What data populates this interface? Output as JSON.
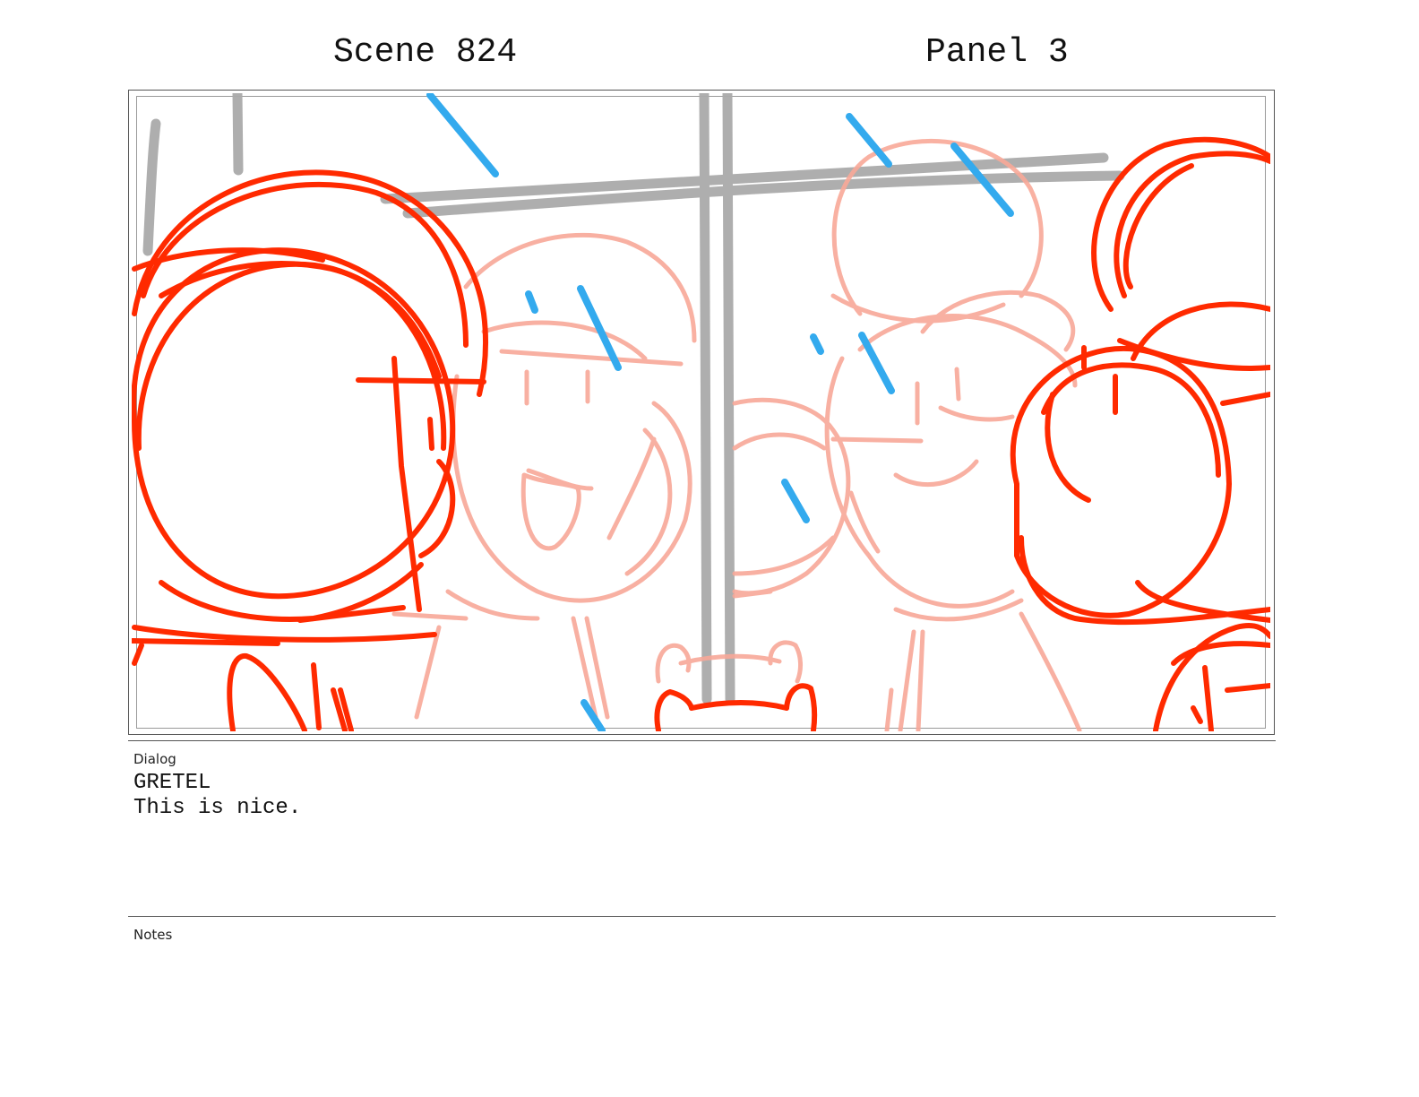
{
  "header": {
    "scene": "Scene 824",
    "panel": "Panel 3"
  },
  "dialog": {
    "label": "Dialog",
    "character": "GRETEL",
    "line": "This is nice."
  },
  "notes": {
    "label": "Notes"
  },
  "colors": {
    "sketch_red": "#ff2a00",
    "sketch_pink": "#f8a898",
    "sketch_blue": "#33aaee",
    "sketch_gray": "#aaaaaa"
  }
}
